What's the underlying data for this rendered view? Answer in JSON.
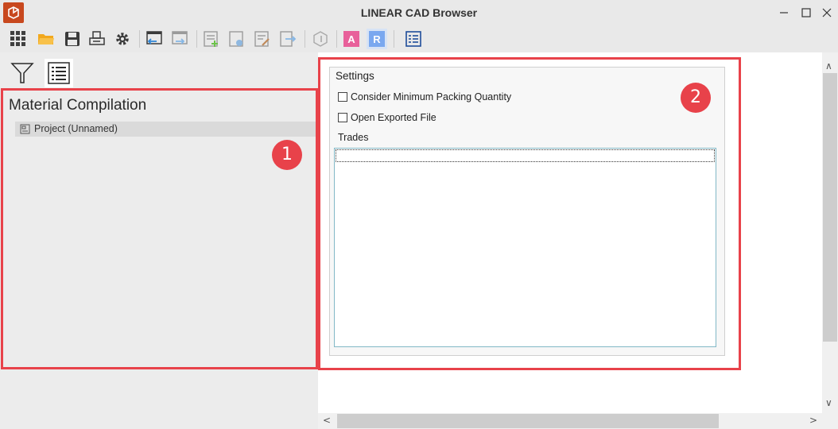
{
  "window": {
    "title": "LINEAR CAD Browser",
    "icons": [
      "app-logo-icon",
      "minimize-icon",
      "maximize-icon",
      "close-icon"
    ]
  },
  "toolbar": {
    "icons": [
      "grid-icon",
      "open-folder-icon",
      "save-icon",
      "print-icon",
      "gear-icon",
      "import-icon",
      "export-icon",
      "list-add-icon",
      "list-view-icon",
      "list-edit-icon",
      "list-export-icon",
      "hexagon-number-icon",
      "a-icon",
      "r-icon",
      "report-icon"
    ],
    "a_label": "A",
    "r_label": "R",
    "accent_pink": "#e8609a",
    "accent_blue": "#7aa8ef"
  },
  "left_pane": {
    "heading": "Material Compilation",
    "tree": [
      {
        "label": "Project (Unnamed)"
      }
    ]
  },
  "settings": {
    "title": "Settings",
    "options": [
      {
        "label": "Consider Minimum Packing Quantity",
        "checked": false
      },
      {
        "label": "Open Exported File",
        "checked": false
      }
    ],
    "trades_label": "Trades",
    "trades": []
  },
  "annotations": [
    {
      "number": "1",
      "color": "#e8424a"
    },
    {
      "number": "2",
      "color": "#e8424a"
    }
  ]
}
